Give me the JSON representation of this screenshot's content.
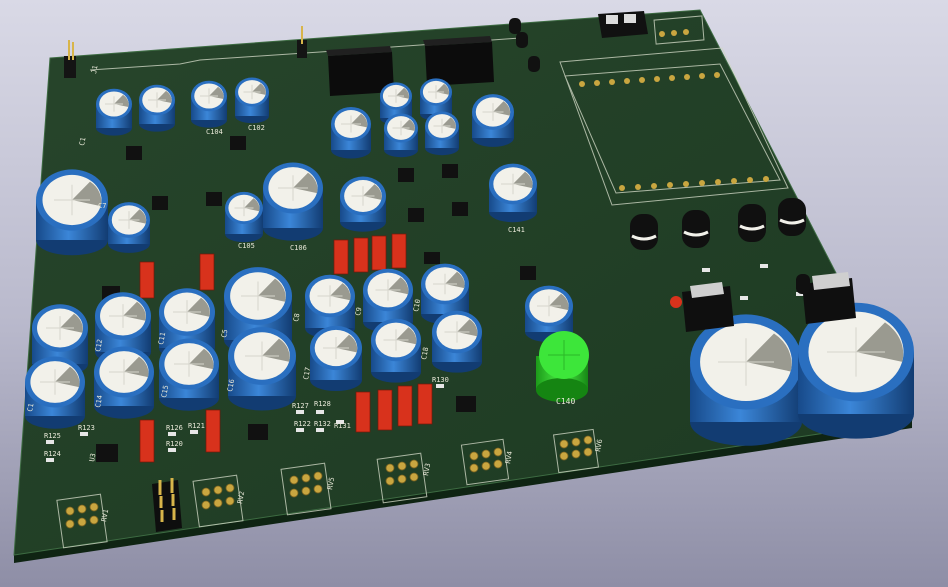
{
  "colors": {
    "board": "#1f3b24",
    "board_edge": "#0f2413",
    "silkscreen": "#e8e8d8",
    "cap_blue": "#2a6fc0",
    "cap_top": "#f2f1ea",
    "film_cap_red": "#d8321c",
    "led_green": "#3de63a",
    "ic_black": "#161616",
    "pad_gold": "#c9a640"
  },
  "capacitor_labels": [
    "C7",
    "C1",
    "C12",
    "C11",
    "C14",
    "C15",
    "C16",
    "C5",
    "C8",
    "C17",
    "C9",
    "C10",
    "C18",
    "C105",
    "C106",
    "C104",
    "C102",
    "C141",
    "C140"
  ],
  "resistor_labels": [
    "R125",
    "R123",
    "R124",
    "R126",
    "R121",
    "R120",
    "R127",
    "R128",
    "R122",
    "R132",
    "R130",
    "R131"
  ],
  "potentiometer_labels": [
    "RV1",
    "RV2",
    "RV5",
    "RV3",
    "RV4",
    "RV6"
  ],
  "misc_labels": [
    "C1",
    "U3",
    "J1"
  ]
}
